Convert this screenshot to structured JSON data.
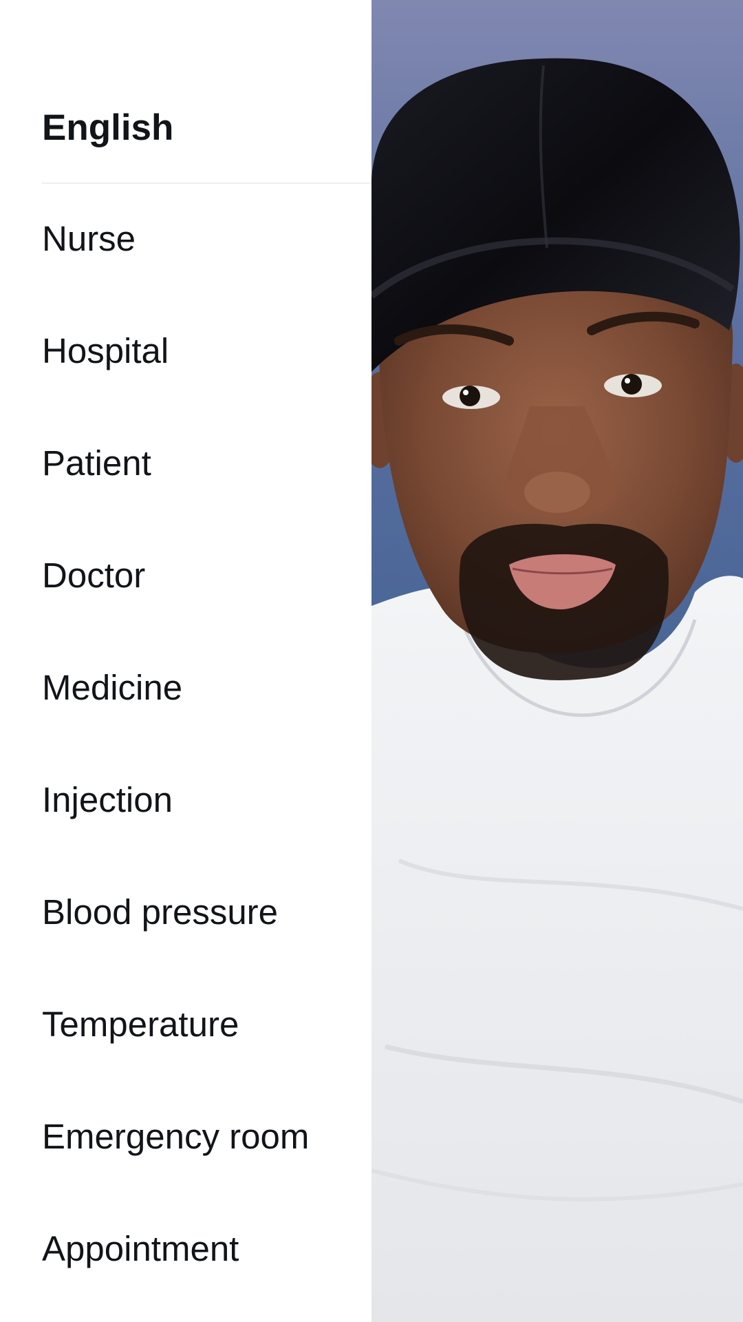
{
  "vocab": {
    "header": "English",
    "words": [
      "Nurse",
      "Hospital",
      "Patient",
      "Doctor",
      "Medicine",
      "Injection",
      "Blood pressure",
      "Temperature",
      "Emergency room",
      "Appointment"
    ]
  },
  "video": {
    "subject": "person-photo",
    "colors": {
      "background": "#5b6fa0",
      "durag": "#0d0d12",
      "skin": "#7a4a34",
      "shirt": "#eef0f3"
    }
  }
}
